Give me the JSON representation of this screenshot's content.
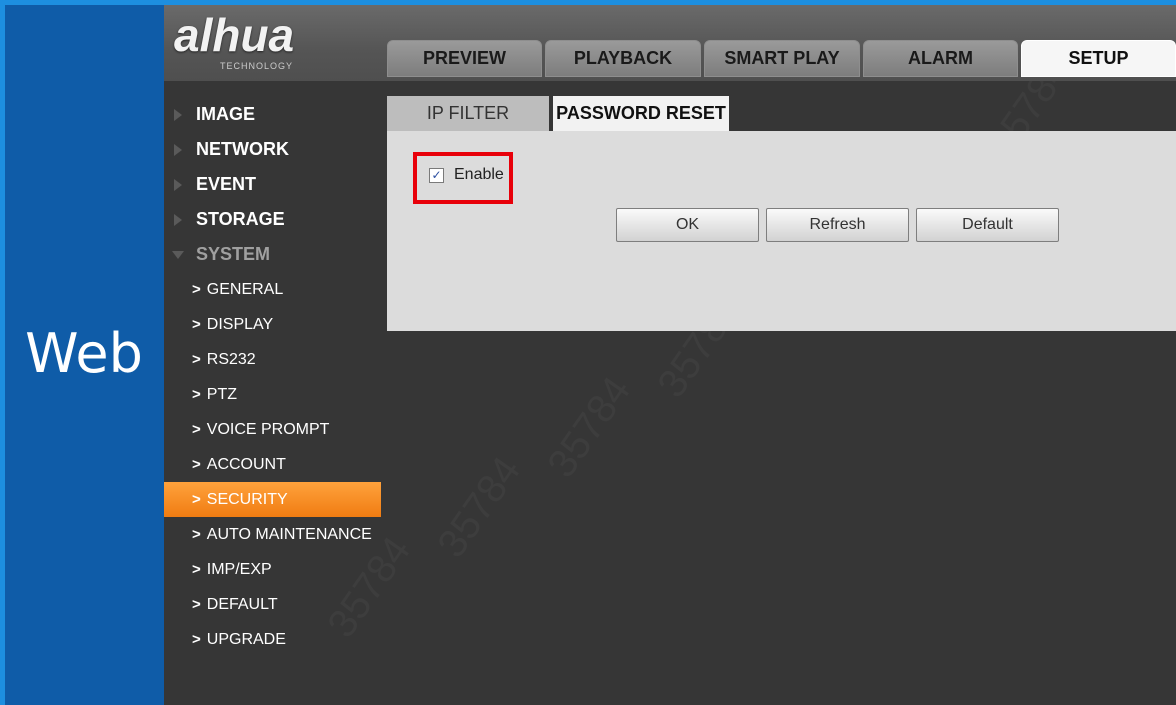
{
  "side_label": "Web",
  "logo": {
    "main": "alhua",
    "sub": "TECHNOLOGY"
  },
  "top_tabs": [
    {
      "label": "PREVIEW",
      "active": false
    },
    {
      "label": "PLAYBACK",
      "active": false
    },
    {
      "label": "SMART PLAY",
      "active": false
    },
    {
      "label": "ALARM",
      "active": false
    },
    {
      "label": "SETUP",
      "active": true
    }
  ],
  "sidebar": {
    "sections": [
      "IMAGE",
      "NETWORK",
      "EVENT",
      "STORAGE"
    ],
    "expanded_section": "SYSTEM",
    "items": [
      "GENERAL",
      "DISPLAY",
      "RS232",
      "PTZ",
      "VOICE PROMPT",
      "ACCOUNT",
      "SECURITY",
      "AUTO MAINTENANCE",
      "IMP/EXP",
      "DEFAULT",
      "UPGRADE"
    ],
    "selected_item": "SECURITY"
  },
  "panel_tabs": [
    {
      "label": "IP FILTER",
      "active": false
    },
    {
      "label": "PASSWORD RESET",
      "active": true
    }
  ],
  "form": {
    "enable_label": "Enable",
    "enable_checked": true,
    "buttons": {
      "ok": "OK",
      "refresh": "Refresh",
      "default": "Default"
    }
  },
  "colors": {
    "selected_item": "#f58a20",
    "highlight_box": "#e8000a",
    "side_background": "#0f5ca8"
  },
  "watermark": "35784"
}
